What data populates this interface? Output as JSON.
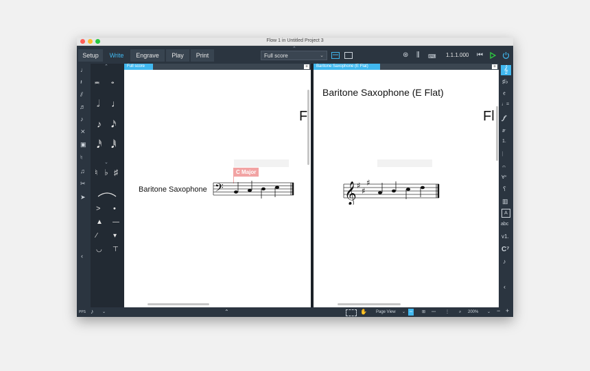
{
  "window": {
    "title": "Flow 1 in Untitled Project 3"
  },
  "modes": [
    {
      "label": "Setup",
      "active": false
    },
    {
      "label": "Write",
      "active": true
    },
    {
      "label": "Engrave",
      "active": false
    },
    {
      "label": "Play",
      "active": false
    },
    {
      "label": "Print",
      "active": false
    }
  ],
  "toolbar": {
    "layout_select": "Full score",
    "timecode": "1.1.1.000"
  },
  "pane_left": {
    "tab": "Full score",
    "instrument_name": "Baritone Saxophone",
    "key_signature_popover": "C Major",
    "cutoff_letter": "F"
  },
  "pane_right": {
    "tab": "Baritone Saxophone (E Flat)",
    "part_title": "Baritone Saxophone (E Flat)",
    "cutoff_letter": "Fl"
  },
  "right_panel": {
    "abc_label": "abc",
    "v1_label": "v1.",
    "chord_label": "C⁷"
  },
  "status": {
    "view_mode": "Page View",
    "zoom": "200%",
    "left_label": "PPS"
  },
  "colors": {
    "accent": "#41b8ef",
    "play": "#2ecc40",
    "popover": "#f2a3a3"
  }
}
